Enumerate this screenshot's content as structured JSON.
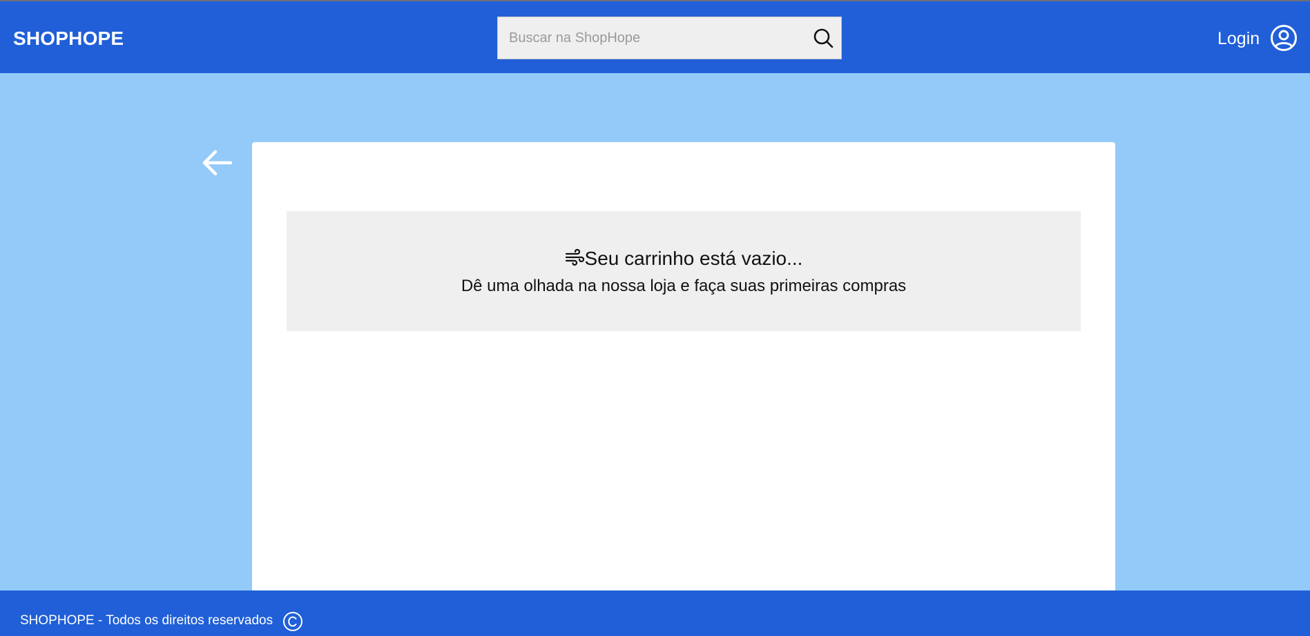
{
  "header": {
    "logo": "SHOPHOPE",
    "search": {
      "placeholder": "Buscar na ShopHope",
      "value": "",
      "icon": "search-icon"
    },
    "login_label": "Login",
    "user_icon": "user-circle-icon"
  },
  "main": {
    "back_icon": "arrow-left-icon",
    "cart": {
      "empty_icon": "wind-icon",
      "empty_title": "Seu carrinho está vazio...",
      "empty_subtitle": "Dê uma olhada na nossa loja e faça suas primeiras compras"
    }
  },
  "footer": {
    "text": "SHOPHOPE - Todos os direitos reservados",
    "icon": "copyright-icon"
  },
  "colors": {
    "primary": "#205fd7",
    "background": "#93caf9",
    "card": "#ffffff",
    "empty_box": "#efefef"
  }
}
